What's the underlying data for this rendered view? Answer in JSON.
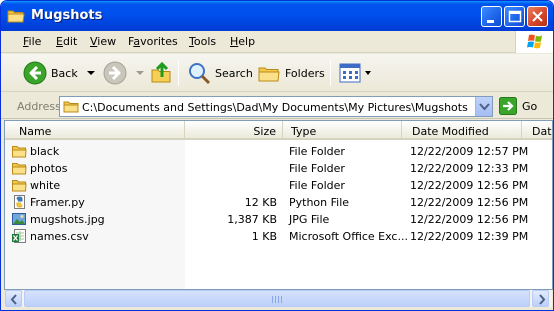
{
  "window": {
    "title": "Mugshots"
  },
  "menu": [
    "File",
    "Edit",
    "View",
    "Favorites",
    "Tools",
    "Help"
  ],
  "menu_underline": [
    "F",
    "E",
    "V",
    "a",
    "T",
    "H"
  ],
  "toolbar": {
    "back_label": "Back",
    "search_label": "Search",
    "folders_label": "Folders"
  },
  "address": {
    "label": "Address",
    "path": "C:\\Documents and Settings\\Dad\\My Documents\\My Pictures\\Mugshots",
    "go_label": "Go"
  },
  "columns": [
    "Name",
    "Size",
    "Type",
    "Date Modified",
    "Dat"
  ],
  "files": [
    {
      "name": "black",
      "size": "",
      "type": "File Folder",
      "date": "12/22/2009 12:57 PM",
      "icon": "folder-icon"
    },
    {
      "name": "photos",
      "size": "",
      "type": "File Folder",
      "date": "12/22/2009 12:33 PM",
      "icon": "folder-icon"
    },
    {
      "name": "white",
      "size": "",
      "type": "File Folder",
      "date": "12/22/2009 12:56 PM",
      "icon": "folder-icon"
    },
    {
      "name": "Framer.py",
      "size": "12 KB",
      "type": "Python File",
      "date": "12/22/2009 12:56 PM",
      "icon": "python-file-icon"
    },
    {
      "name": "mugshots.jpg",
      "size": "1,387 KB",
      "type": "JPG File",
      "date": "12/22/2009 12:56 PM",
      "icon": "image-file-icon"
    },
    {
      "name": "names.csv",
      "size": "1 KB",
      "type": "Microsoft Office Exc...",
      "date": "12/22/2009 12:39 PM",
      "icon": "excel-file-icon"
    }
  ],
  "colors": {
    "titlebar": "#0053ee",
    "chrome": "#ece9d8",
    "border": "#7f9db9"
  }
}
